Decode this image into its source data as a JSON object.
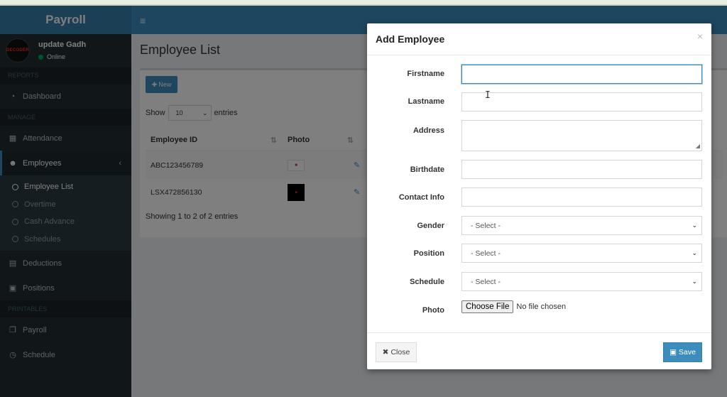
{
  "app": {
    "logo": "Payroll"
  },
  "user": {
    "name": "update Gadh",
    "status": "Online",
    "avatar_text": "DECODER"
  },
  "sidebar": {
    "reports_header": "REPORTS",
    "dashboard": "Dashboard",
    "manage_header": "MANAGE",
    "attendance": "Attendance",
    "employees": "Employees",
    "employees_sub": [
      "Employee List",
      "Overtime",
      "Cash Advance",
      "Schedules"
    ],
    "deductions": "Deductions",
    "positions": "Positions",
    "printables_header": "PRINTABLES",
    "payroll": "Payroll",
    "schedule": "Schedule"
  },
  "page": {
    "title": "Employee List",
    "new_button": "New",
    "show_label": "Show",
    "entries_label": "entries",
    "length_value": "10",
    "columns": [
      "Employee ID",
      "Photo"
    ],
    "rows": [
      {
        "id": "ABC123456789"
      },
      {
        "id": "LSX472856130"
      }
    ],
    "info": "Showing 1 to 2 of 2 entries"
  },
  "modal": {
    "title": "Add Employee",
    "labels": {
      "firstname": "Firstname",
      "lastname": "Lastname",
      "address": "Address",
      "birthdate": "Birthdate",
      "contact": "Contact Info",
      "gender": "Gender",
      "position": "Position",
      "schedule": "Schedule",
      "photo": "Photo"
    },
    "select_placeholder": "- Select -",
    "file_button": "Choose File",
    "file_status": "No file chosen",
    "close_button": "Close",
    "save_button": "Save"
  },
  "colors": {
    "primary": "#3c8dbc",
    "sidebar": "#222d32",
    "online": "#00a65a"
  }
}
